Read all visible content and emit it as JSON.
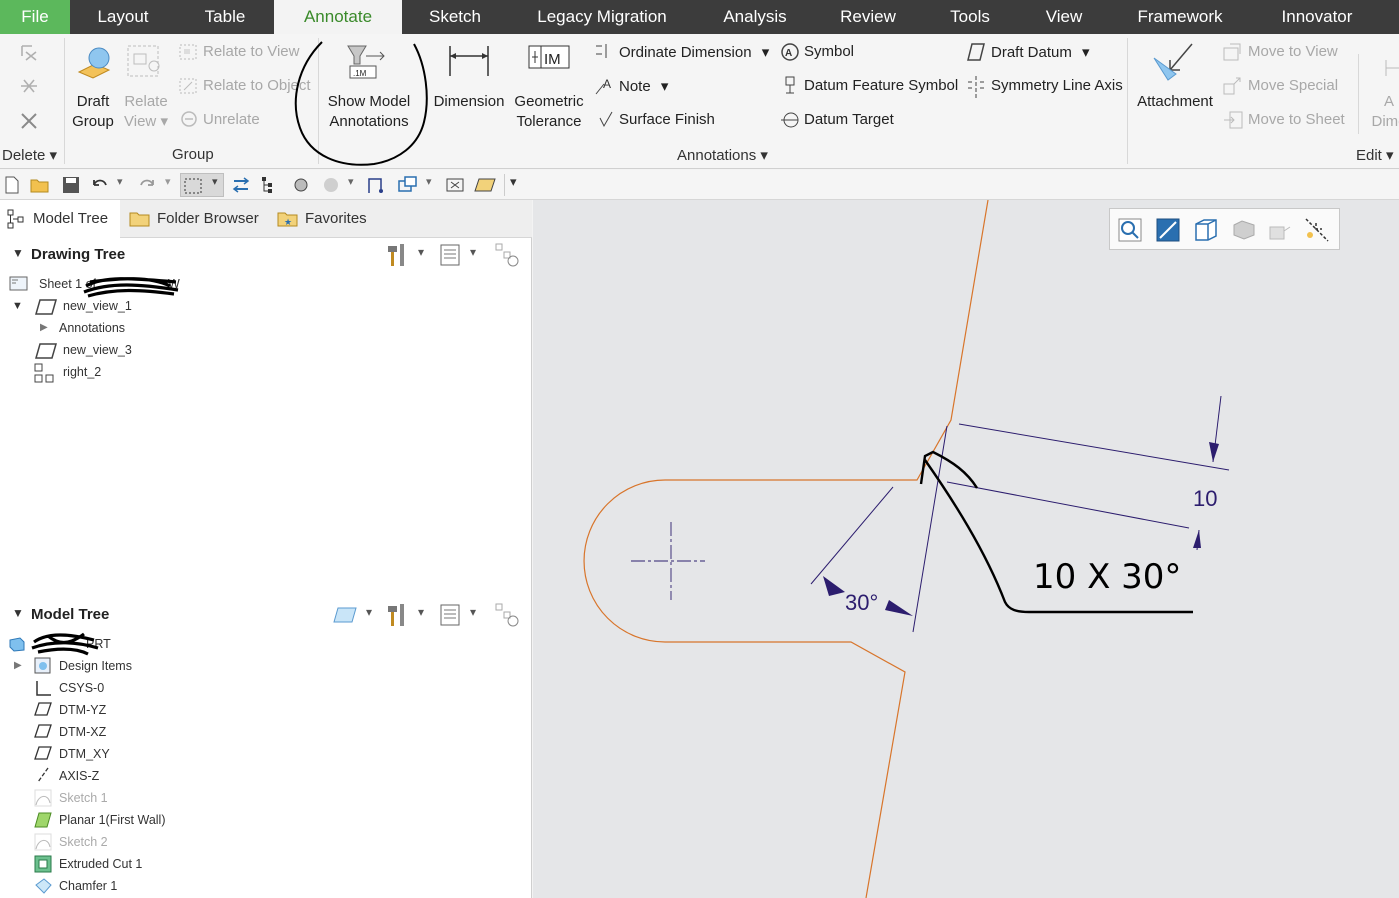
{
  "menu": {
    "file": "File",
    "items": [
      "Layout",
      "Table",
      "Annotate",
      "Sketch",
      "Legacy Migration",
      "Analysis",
      "Review",
      "Tools",
      "View",
      "Framework",
      "Innovator"
    ]
  },
  "ribbon": {
    "delete_group_label": "Delete",
    "group_group": {
      "draft_group_line1": "Draft",
      "draft_group_line2": "Group",
      "relate_view_line1": "Relate",
      "relate_view_line2": "View",
      "relate_to_view": "Relate to View",
      "relate_to_object": "Relate to Object",
      "unrelate": "Unrelate",
      "label": "Group"
    },
    "annotations_group": {
      "show_model_line1": "Show Model",
      "show_model_line2": "Annotations",
      "dimension": "Dimension",
      "geometric_line1": "Geometric",
      "geometric_line2": "Tolerance",
      "ordinate_dimension": "Ordinate Dimension",
      "note": "Note",
      "surface_finish": "Surface Finish",
      "symbol": "Symbol",
      "datum_feature_symbol": "Datum Feature Symbol",
      "datum_target": "Datum Target",
      "draft_datum": "Draft Datum",
      "symmetry_line_axis": "Symmetry Line Axis",
      "label": "Annotations",
      "gtol_icon_text": "IM"
    },
    "edit_group": {
      "attachment": "Attachment",
      "move_to_view": "Move to View",
      "move_special": "Move Special",
      "move_to_sheet": "Move to Sheet",
      "cut_line1": "A",
      "cut_line2": "Dime",
      "label": "Edit"
    }
  },
  "left_pane": {
    "tabs": [
      "Model Tree",
      "Folder Browser",
      "Favorites"
    ],
    "drawing_tree": {
      "title": "Drawing Tree",
      "items": [
        "Sheet 1 of",
        "new_view_1",
        "Annotations",
        "new_view_3",
        "right_2"
      ],
      "sheet_suffix": "W"
    },
    "model_tree": {
      "title": "Model Tree",
      "root_suffix": "PRT",
      "items": [
        "Design Items",
        "CSYS-0",
        "DTM-YZ",
        "DTM-XZ",
        "DTM_XY",
        "AXIS-Z",
        "Sketch 1",
        "Planar 1(First Wall)",
        "Sketch 2",
        "Extruded Cut 1",
        "Chamfer 1"
      ]
    }
  },
  "canvas": {
    "dim_angle": "30°",
    "dim_length": "10",
    "handwritten_note": "10 X 30°"
  },
  "colors": {
    "menubar": "#3c3c3c",
    "file_tab": "#5cb85c",
    "active_tab_text": "#3a8a2a",
    "geometry": "#d8752b",
    "dimension": "#2c1d6e"
  }
}
